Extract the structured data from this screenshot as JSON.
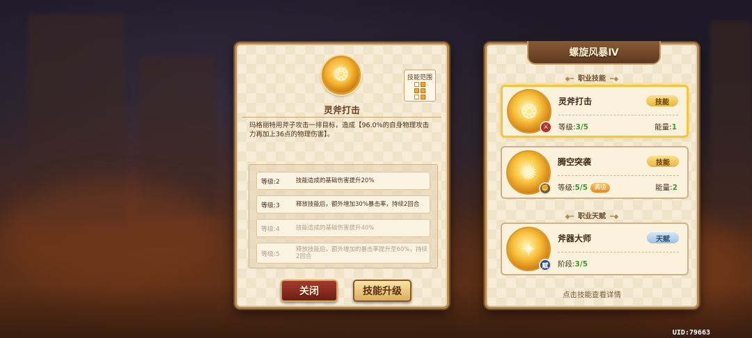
{
  "skill_detail": {
    "skill_name": "灵斧打击",
    "range_label": "技能范围",
    "range_grid": [
      [
        false,
        true
      ],
      [
        true,
        true
      ],
      [
        false,
        true
      ]
    ],
    "description": "玛格丽特用斧子攻击一排目标，造成【96.0%的自身物理攻击力再加上36点的物理伤害】。",
    "levels": [
      {
        "level": "等级:2",
        "effect": "技能造成的基础伤害提升20%",
        "unlocked": true
      },
      {
        "level": "等级:3",
        "effect": "释放技能后，额外增加30%暴击率，持续2回合",
        "unlocked": true
      },
      {
        "level": "等级:4",
        "effect": "技能造成的基础伤害提升40%",
        "unlocked": false
      },
      {
        "level": "等级:5",
        "effect": "释放技能后，额外增加的暴击率提升至60%，持续2回合",
        "unlocked": false
      }
    ],
    "close_label": "关闭",
    "upgrade_label": "技能升级"
  },
  "class_panel": {
    "title": "螺旋风暴Ⅳ",
    "class_skills_label": "职业技能",
    "class_talent_label": "职业天赋",
    "skills": [
      {
        "name": "灵斧打击",
        "tag": "技能",
        "level_label": "等级:",
        "level_value": "3/5",
        "energy_label": "能量:",
        "energy_value": "1",
        "maxed": false,
        "badge_icon": "sword-icon",
        "badge_color": "#b4322a"
      },
      {
        "name": "腾空突袭",
        "tag": "技能",
        "level_label": "等级:",
        "level_value": "5/5",
        "maxed_label": "满级",
        "energy_label": "能量:",
        "energy_value": "2",
        "maxed": true,
        "badge_icon": "fist-icon",
        "badge_color": "#6b5a4a"
      }
    ],
    "talent": {
      "name": "斧器大师",
      "tag": "天赋",
      "stage_label": "阶段:",
      "stage_value": "3/5",
      "badge_text": "赋",
      "badge_color": "#2f4d8c"
    },
    "hint": "点击技能查看详情"
  },
  "uid": "UID:79663",
  "colors": {
    "panel_bg": "#f6ecd7",
    "accent_gold": "#f3c640",
    "green_value": "#3c9a2f",
    "close_button": "#8a2b20",
    "ribbon": "#6e4428"
  }
}
